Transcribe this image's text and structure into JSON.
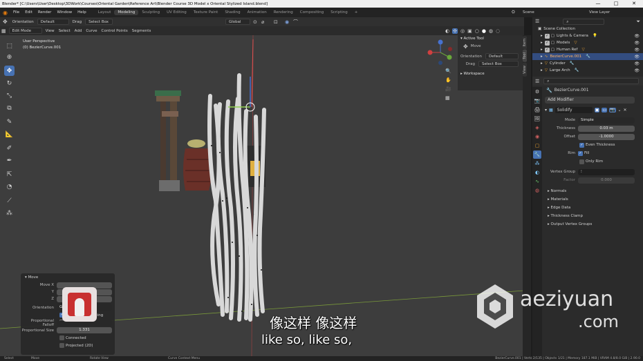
{
  "window": {
    "title": "Blender* [C:\\Users\\User\\Desktop\\3DWork\\Courses\\Oriental Garden\\Reference Art\\Blender Course 3D Model x Oriental Stylized Island.blend]",
    "minimize": "—",
    "maximize": "□",
    "close": "✕"
  },
  "menu": [
    "File",
    "Edit",
    "Render",
    "Window",
    "Help"
  ],
  "workspaces": [
    "Layout",
    "Modeling",
    "Sculpting",
    "UV Editing",
    "Texture Paint",
    "Shading",
    "Animation",
    "Rendering",
    "Compositing",
    "Scripting"
  ],
  "active_workspace": "Modeling",
  "scene_label": "Scene",
  "view_layer_label": "View Layer",
  "viewport_header": {
    "orientation_label": "Orientation",
    "orientation_value": "Default",
    "drag_label": "Drag",
    "drag_value": "Select Box",
    "transform_orientation": "Global",
    "mode": "Edit Mode",
    "menus": [
      "View",
      "Select",
      "Add",
      "Curve",
      "Control Points",
      "Segments"
    ]
  },
  "viewport_info": {
    "perspective": "User Perspective",
    "object": "(0) BezierCurve.001"
  },
  "npanel": {
    "active_tool_title": "Active Tool",
    "tool_name": "Move",
    "orientation_label": "Orientation",
    "orientation_value": "Default",
    "drag_label": "Drag",
    "drag_value": "Select Box",
    "workspace_title": "Workspace",
    "tabs": [
      "Item",
      "Tool",
      "View"
    ]
  },
  "outliner": {
    "root": "Scene Collection",
    "items": [
      {
        "label": "Lights & Camera"
      },
      {
        "label": "Models"
      },
      {
        "label": "Human Ref"
      },
      {
        "label": "BezierCurve.001"
      },
      {
        "label": "Cylinder"
      },
      {
        "label": "Large Arch"
      }
    ],
    "selected_index": 3
  },
  "properties": {
    "object_name": "BezierCurve.001",
    "add_modifier": "Add Modifier",
    "modifier_name": "Solidify",
    "mode_label": "Mode",
    "mode_value": "Simple",
    "thickness_label": "Thickness",
    "thickness_value": "0.03 m",
    "offset_label": "Offset",
    "offset_value": "-1.0000",
    "even_thickness_label": "Even Thickness",
    "rim_label": "Rim",
    "fill_label": "Fill",
    "only_rim_label": "Only Rim",
    "vertex_group_label": "Vertex Group",
    "factor_label": "Factor",
    "factor_value": "0.000",
    "subpanels": [
      "Normals",
      "Materials",
      "Edge Data",
      "Thickness Clamp",
      "Output Vertex Groups"
    ]
  },
  "operator_panel": {
    "title": "Move",
    "move_x_label": "Move X",
    "y_label": "Y",
    "z_label": "Z",
    "orientation_label": "Orientation",
    "orientation_value": "Global",
    "proportional_editing_label": "Proportional Editing",
    "proportional_falloff_label": "Proportional Falloff",
    "proportional_size_label": "Proportional Size",
    "proportional_size_value": "1.331",
    "connected_label": "Connected",
    "projected_label": "Projected (2D)"
  },
  "status_bar": {
    "left": [
      "Select",
      "Move",
      "Rotate View",
      "Curve Context Menu"
    ],
    "right": "BezierCurve.001 | Verts 2/135 | Objects 1/21 | Memory 187.1 MiB | VRAM 4.8/8.0 GiB | 2.90.0"
  },
  "subtitles": {
    "chinese": "像这样 像这样",
    "english": "like so, like so,"
  },
  "watermark": {
    "line1": "aeziyuan",
    "line2": ".com"
  },
  "colors": {
    "accent": "#4772b3",
    "viewport_bg": "#3d3d3d",
    "selected_row": "#334d80"
  }
}
